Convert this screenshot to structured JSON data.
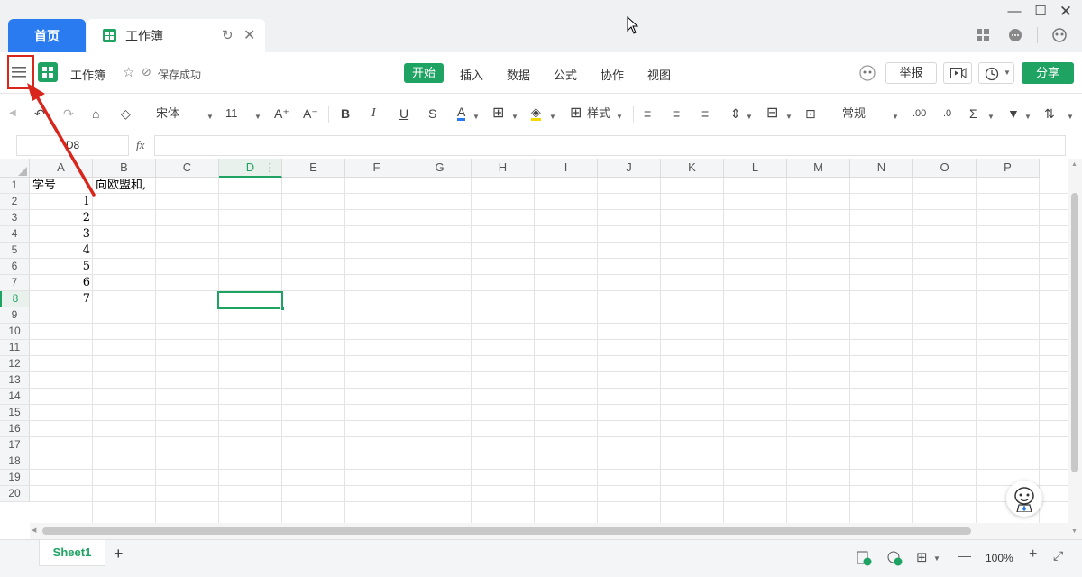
{
  "tabs": {
    "home": "首页",
    "workbook": "工作簿"
  },
  "menubar": {
    "doc_name": "工作簿",
    "save_status": "保存成功",
    "menus": [
      "开始",
      "插入",
      "数据",
      "公式",
      "协作",
      "视图"
    ],
    "report": "举报",
    "share": "分享"
  },
  "toolbar": {
    "font": "宋体",
    "size": "11",
    "style_label": "样式",
    "number_format": "常规",
    "bold": "B",
    "italic": "I",
    "underline": "U",
    "strike": "S",
    "fontcolor": "A"
  },
  "formula": {
    "namebox": "D8",
    "fx": "fx"
  },
  "grid": {
    "columns": [
      "A",
      "B",
      "C",
      "D",
      "E",
      "F",
      "G",
      "H",
      "I",
      "J",
      "K",
      "L",
      "M",
      "N",
      "O",
      "P"
    ],
    "rows": [
      "1",
      "2",
      "3",
      "4",
      "5",
      "6",
      "7",
      "8",
      "9",
      "10",
      "11",
      "12",
      "13",
      "14",
      "15",
      "16",
      "17",
      "18",
      "19",
      "20"
    ],
    "active_cell": "D8",
    "cells": [
      {
        "ref": "A1",
        "value": "学号"
      },
      {
        "ref": "B1",
        "value": "向欧盟和,"
      },
      {
        "ref": "A2",
        "value": "1"
      },
      {
        "ref": "A3",
        "value": "2"
      },
      {
        "ref": "A4",
        "value": "3"
      },
      {
        "ref": "A5",
        "value": "4"
      },
      {
        "ref": "A6",
        "value": "5"
      },
      {
        "ref": "A7",
        "value": "6"
      },
      {
        "ref": "A8",
        "value": "7"
      }
    ]
  },
  "sheetbar": {
    "sheet": "Sheet1",
    "add": "+",
    "zoom": "100%"
  },
  "colors": {
    "accent": "#1fa363",
    "home_tab": "#2b7bf0",
    "annotation": "#d9261c"
  }
}
